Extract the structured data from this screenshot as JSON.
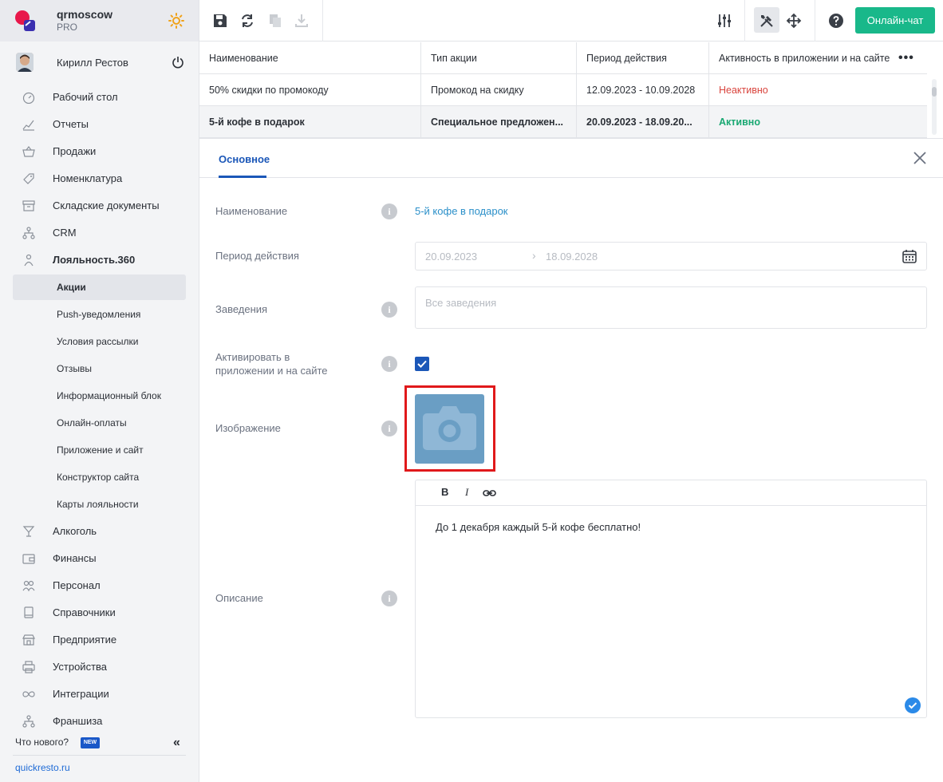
{
  "brand": {
    "name": "qrmoscow",
    "plan": "PRO"
  },
  "user": {
    "name": "Кирилл Рестов"
  },
  "nav": [
    {
      "label": "Рабочий стол",
      "icon": "dashboard-icon"
    },
    {
      "label": "Отчеты",
      "icon": "chart-icon"
    },
    {
      "label": "Продажи",
      "icon": "basket-icon"
    },
    {
      "label": "Номенклатура",
      "icon": "tag-icon"
    },
    {
      "label": "Складские документы",
      "icon": "archive-icon"
    },
    {
      "label": "CRM",
      "icon": "hierarchy-icon"
    },
    {
      "label": "Лояльность.360",
      "icon": "loyalty-icon"
    }
  ],
  "loyalty_sub": [
    "Акции",
    "Push-уведомления",
    "Условия рассылки",
    "Отзывы",
    "Информационный блок",
    "Онлайн-оплаты",
    "Приложение и сайт",
    "Конструктор сайта",
    "Карты лояльности"
  ],
  "nav_bottom": [
    {
      "label": "Алкоголь",
      "icon": "cocktail-icon"
    },
    {
      "label": "Финансы",
      "icon": "wallet-icon"
    },
    {
      "label": "Персонал",
      "icon": "people-icon"
    },
    {
      "label": "Справочники",
      "icon": "book-icon"
    },
    {
      "label": "Предприятие",
      "icon": "store-icon"
    },
    {
      "label": "Устройства",
      "icon": "printer-icon"
    },
    {
      "label": "Интеграции",
      "icon": "infinity-icon"
    },
    {
      "label": "Франшиза",
      "icon": "franchise-icon"
    }
  ],
  "footer": {
    "whats_new": "Что нового?",
    "badge": "NEW",
    "site": "quickresto.ru"
  },
  "toolbar": {
    "chat": "Онлайн-чат"
  },
  "table": {
    "headers": [
      "Наименование",
      "Тип акции",
      "Период действия",
      "Активность в приложении и на сайте"
    ],
    "rows": [
      {
        "name": "50% скидки по промокоду",
        "type": "Промокод на скидку",
        "period": "12.09.2023 - 10.09.2028",
        "status": "Неактивно"
      },
      {
        "name": "5-й кофе в подарок",
        "type": "Специальное предложен...",
        "period": "20.09.2023 - 18.09.20...",
        "status": "Активно"
      }
    ]
  },
  "form": {
    "tab": "Основное",
    "labels": {
      "name": "Наименование",
      "period": "Период действия",
      "venues": "Заведения",
      "activate": "Активировать в приложении и на сайте",
      "image": "Изображение",
      "description": "Описание"
    },
    "name_value": "5-й кофе в подарок",
    "date_from": "20.09.2023",
    "date_to": "18.09.2028",
    "venues_placeholder": "Все заведения",
    "activate_checked": true,
    "editor": {
      "bold": "B",
      "italic": "I",
      "text": "До 1 декабря каждый 5-й кофе бесплатно!"
    }
  },
  "colors": {
    "accent": "#1b57b8",
    "chat": "#19b88a",
    "inactive": "#d9443d",
    "active": "#19a872",
    "link": "#2a8fc9"
  }
}
